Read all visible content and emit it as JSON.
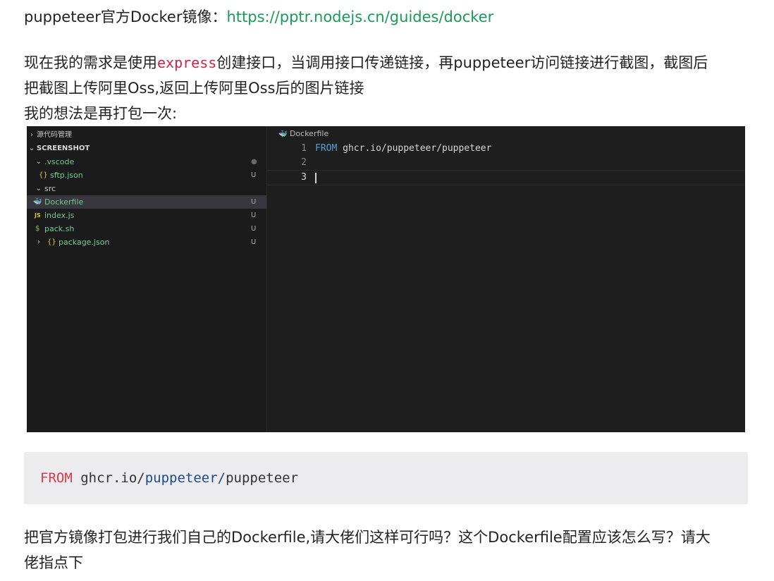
{
  "intro": {
    "label": "puppeteer官方Docker镜像：",
    "link": "https://pptr.nodejs.cn/guides/docker"
  },
  "paragraph1": {
    "part1": "现在我的需求是使用",
    "code": "express",
    "part2": "创建接口，当调用接口传递链接，再puppeteer访问链接进行截图，截图后",
    "line2": "把截图上传阿里Oss,返回上传阿里Oss后的图片链接",
    "line3": "我的想法是再打包一次:"
  },
  "editor": {
    "sidebar": {
      "source_control": "源代码管理",
      "project": "SCREENSHOT",
      "items": [
        {
          "name": ".vscode",
          "status": "●",
          "icon": "chevron-down-icon"
        },
        {
          "name": "sftp.json",
          "status": "U",
          "icon": "{}"
        },
        {
          "name": "src",
          "status": "",
          "icon": "chevron-down-icon"
        },
        {
          "name": "Dockerfile",
          "status": "U",
          "icon": "docker-icon"
        },
        {
          "name": "index.js",
          "status": "U",
          "icon": "JS"
        },
        {
          "name": "pack.sh",
          "status": "U",
          "icon": "$"
        },
        {
          "name": "package.json",
          "status": "U",
          "icon": "{}"
        }
      ]
    },
    "tab": "Dockerfile",
    "code": {
      "line1_num": "1",
      "line1_kw": "FROM",
      "line1_rest": " ghcr.io/puppeteer/puppeteer",
      "line2_num": "2",
      "line3_num": "3"
    }
  },
  "codeblock": {
    "kw": "FROM",
    "part1": " ghcr.io/",
    "part2": "puppeteer/",
    "part3": "puppeteer"
  },
  "paragraph2": {
    "line1": "把官方镜像打包进行我们自己的Dockerfile,请大佬们这样可行吗？这个Dockerfile配置应该怎么写？请大",
    "line2": "佬指点下"
  }
}
